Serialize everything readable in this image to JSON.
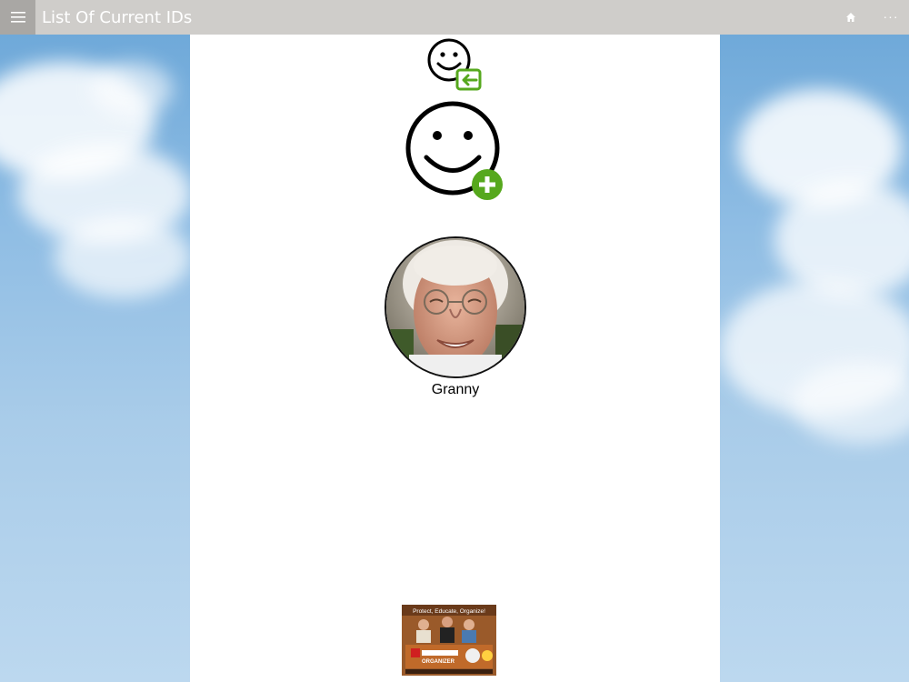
{
  "window": {
    "title": "List Of Current IDs"
  },
  "toolbar": {
    "more_label": "···"
  },
  "icons": {
    "menu": "hamburger-menu-icon",
    "home": "home-icon",
    "switch_user": "smiley-switch-icon",
    "add_user": "smiley-add-icon"
  },
  "colors": {
    "accent_green": "#56a81d",
    "titlebar": "#cfcdca"
  },
  "profiles": [
    {
      "name": "Granny"
    }
  ],
  "ad": {
    "tagline": "Protect, Educate, Organize!",
    "brand": "ORGANIZER"
  }
}
